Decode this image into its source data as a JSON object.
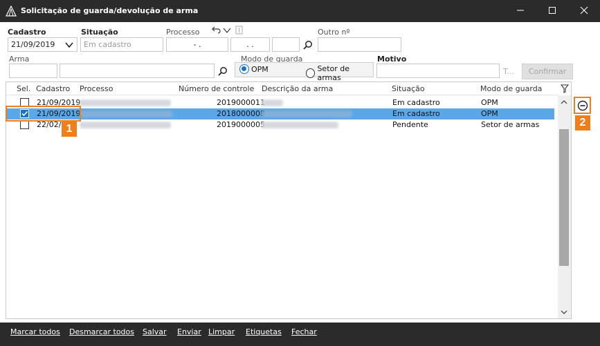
{
  "window": {
    "title": "Solicitação de guarda/devolução de arma",
    "icon": "tent-app-icon",
    "controls": [
      "minimize-icon",
      "maximize-icon",
      "close-icon"
    ]
  },
  "filters": {
    "cadastro_label": "Cadastro",
    "cadastro_value": "21/09/2019",
    "situacao_label": "Situação",
    "situacao_placeholder": "Em cadastro",
    "processo_label": "Processo",
    "processo_part1": "- .",
    "processo_part2": ". .",
    "outro_label": "Outro nº",
    "arma_label": "Arma",
    "modo_label": "Modo de guarda",
    "modo_options": [
      "OPM",
      "Setor de armas"
    ],
    "modo_selected": "OPM",
    "motivo_label": "Motivo",
    "motivo_ellipsis": "T...",
    "confirm_label": "Confirmar"
  },
  "grid": {
    "columns": [
      "Sel.",
      "Cadastro",
      "Processo",
      "Número de controle",
      "Descrição da arma",
      "Situação",
      "Modo de guarda"
    ],
    "rows": [
      {
        "marker": "",
        "checked": false,
        "cadastro": "21/09/2019",
        "processo": "",
        "controle": "2019000011",
        "descricao": "",
        "situacao": "Em cadastro",
        "modo": "OPM",
        "selected": false
      },
      {
        "marker": "*",
        "checked": true,
        "cadastro": "21/09/2019",
        "processo": "",
        "controle": "2018000008",
        "descricao": "",
        "situacao": "Em cadastro",
        "modo": "OPM",
        "selected": true
      },
      {
        "marker": "",
        "checked": false,
        "cadastro": "22/02/",
        "processo": "",
        "controle": "2019000005",
        "descricao": "",
        "situacao": "Pendente",
        "modo": "Setor de armas",
        "selected": false
      }
    ]
  },
  "callouts": [
    "1",
    "2"
  ],
  "footer": {
    "buttons": [
      "Marcar todos",
      "Desmarcar todos",
      "Salvar",
      "Enviar",
      "Limpar",
      "Etiquetas",
      "Fechar"
    ]
  },
  "colors": {
    "titlebar": "#2b2b2b",
    "selection": "#5aa8e8",
    "accent": "#1a73c9",
    "callout": "#f07e1b"
  }
}
